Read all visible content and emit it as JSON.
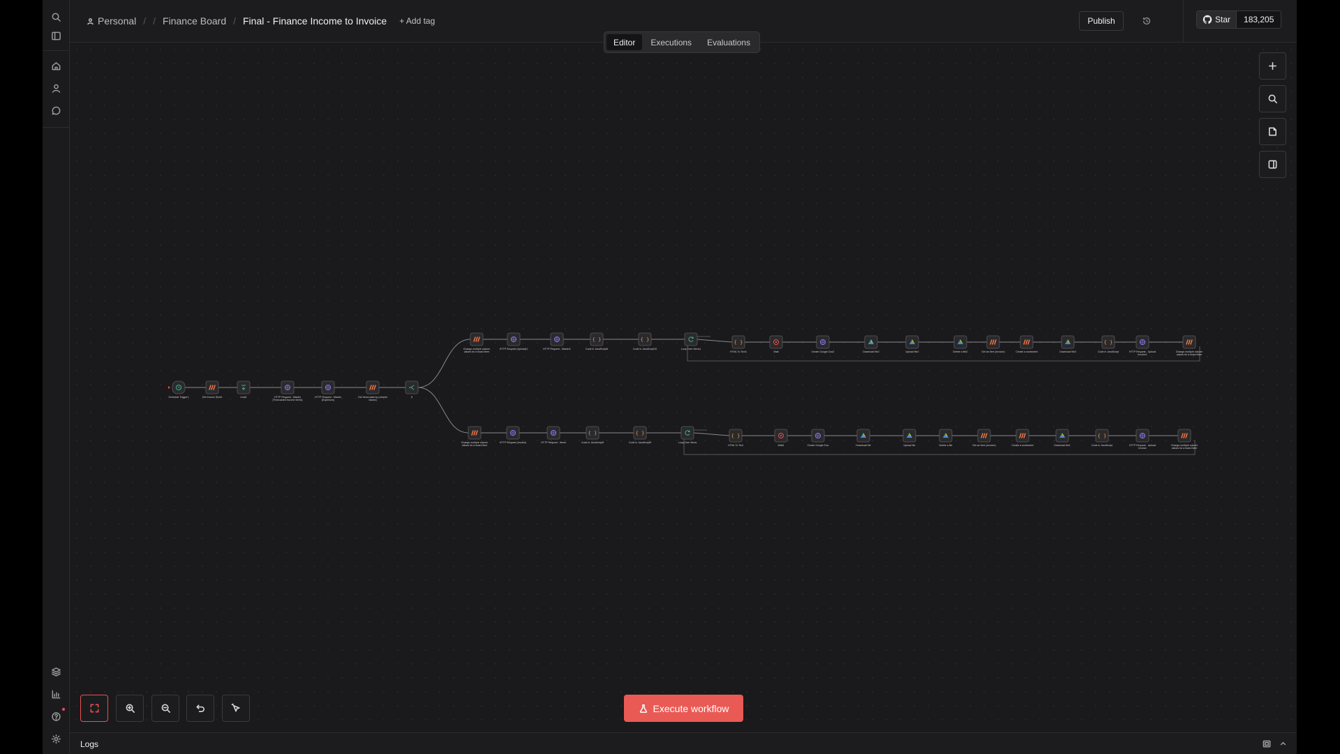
{
  "breadcrumb": {
    "project": "Personal",
    "folder": "Finance Board",
    "workflow": "Final - Finance Income to Invoice",
    "add_tag": "+ Add tag"
  },
  "header": {
    "publish": "Publish",
    "github_star": "Star",
    "github_count": "183,205"
  },
  "tabs": [
    {
      "label": "Editor",
      "active": true
    },
    {
      "label": "Executions",
      "active": false
    },
    {
      "label": "Evaluations",
      "active": false
    }
  ],
  "toolbar": {
    "execute": "Execute workflow"
  },
  "logs": {
    "label": "Logs"
  },
  "sidebar_icons": [
    "search-icon",
    "panel-icon",
    "home-icon",
    "user-icon",
    "chat-icon",
    "templates-icon",
    "insights-icon",
    "help-icon",
    "settings-icon"
  ],
  "colors": {
    "accent": "#ea5a55",
    "canvas": "#1a1a1c",
    "node": "#2a2a2d",
    "edge": "#8a8a90"
  },
  "flow": {
    "nodes": [
      {
        "id": "n1",
        "icon": "trigger",
        "title": "Schedule Trigger1",
        "sub": ""
      },
      {
        "id": "n2",
        "icon": "sheets",
        "title": "Get Invoice Sheet",
        "sub": ""
      },
      {
        "id": "n3",
        "icon": "limit",
        "title": "Limit1",
        "sub": ""
      },
      {
        "id": "n4",
        "icon": "http",
        "title": "HTTP Request - Master (Forecasted Income Items)",
        "sub": ""
      },
      {
        "id": "n5",
        "icon": "http",
        "title": "HTTP Request - Master (Expenses)",
        "sub": ""
      },
      {
        "id": "n6",
        "icon": "sheets",
        "title": "Get items data by (newest values)",
        "sub": ""
      },
      {
        "id": "n7",
        "icon": "if",
        "title": "If",
        "sub": ""
      },
      {
        "id": "u1",
        "icon": "sheets",
        "title": "Change multiple column values for a board item",
        "sub": ""
      },
      {
        "id": "u2",
        "icon": "http",
        "title": "HTTP Request (Upload)1",
        "sub": ""
      },
      {
        "id": "u3",
        "icon": "http",
        "title": "HTTP Request - Master1",
        "sub": ""
      },
      {
        "id": "u4",
        "icon": "code",
        "title": "Code in JavaScript6",
        "sub": ""
      },
      {
        "id": "u5",
        "icon": "code",
        "title": "Code in JavaScript10",
        "sub": ""
      },
      {
        "id": "u6",
        "icon": "loop",
        "title": "Loop Over Items1",
        "sub": ""
      },
      {
        "id": "u7",
        "icon": "code",
        "title": "HTML To Text1",
        "sub": ""
      },
      {
        "id": "u8",
        "icon": "wait",
        "title": "Wait",
        "sub": ""
      },
      {
        "id": "u9",
        "icon": "http",
        "title": "Create Google Doc2",
        "sub": ""
      },
      {
        "id": "u10",
        "icon": "drive",
        "title": "Download file2",
        "sub": ""
      },
      {
        "id": "u11",
        "icon": "drive",
        "title": "Upload file2",
        "sub": ""
      },
      {
        "id": "u12",
        "icon": "drive",
        "title": "Delete a file2",
        "sub": ""
      },
      {
        "id": "u13",
        "icon": "sheets",
        "title": "Get an item (Invoice)",
        "sub": ""
      },
      {
        "id": "u14",
        "icon": "sheets",
        "title": "Create a worksheet",
        "sub": ""
      },
      {
        "id": "u15",
        "icon": "drive",
        "title": "Download file3",
        "sub": ""
      },
      {
        "id": "u16",
        "icon": "code",
        "title": "Code in JavaScript",
        "sub": ""
      },
      {
        "id": "u17",
        "icon": "http",
        "title": "HTTP Request - Upload Invoice1",
        "sub": ""
      },
      {
        "id": "u18",
        "icon": "sheets",
        "title": "Change multiple column values for a board item",
        "sub": ""
      },
      {
        "id": "l1",
        "icon": "sheets",
        "title": "Change multiple column values for a board item",
        "sub": ""
      },
      {
        "id": "l2",
        "icon": "http",
        "title": "HTTP Request (Invoice)",
        "sub": ""
      },
      {
        "id": "l3",
        "icon": "http",
        "title": "HTTP Request - Items",
        "sub": ""
      },
      {
        "id": "l4",
        "icon": "code",
        "title": "Code in JavaScript5",
        "sub": ""
      },
      {
        "id": "l5",
        "icon": "code",
        "title": "Code in JavaScript9",
        "sub": ""
      },
      {
        "id": "l6",
        "icon": "loop",
        "title": "Loop Over Items",
        "sub": ""
      },
      {
        "id": "l7",
        "icon": "code",
        "title": "HTML To Text",
        "sub": ""
      },
      {
        "id": "l8",
        "icon": "wait",
        "title": "Wait1",
        "sub": ""
      },
      {
        "id": "l9",
        "icon": "http",
        "title": "Create Google Doc",
        "sub": ""
      },
      {
        "id": "l10",
        "icon": "drive",
        "title": "Download file",
        "sub": ""
      },
      {
        "id": "l11",
        "icon": "drive",
        "title": "Upload file",
        "sub": ""
      },
      {
        "id": "l12",
        "icon": "drive",
        "title": "Delete a file",
        "sub": ""
      },
      {
        "id": "l13",
        "icon": "sheets",
        "title": "Get an item (Invoice)",
        "sub": ""
      },
      {
        "id": "l14",
        "icon": "sheets",
        "title": "Create a worksheet",
        "sub": ""
      },
      {
        "id": "l15",
        "icon": "drive",
        "title": "Download file1",
        "sub": ""
      },
      {
        "id": "l16",
        "icon": "code",
        "title": "Code in JavaScript",
        "sub": ""
      },
      {
        "id": "l17",
        "icon": "http",
        "title": "HTTP Request - Upload Invoice",
        "sub": ""
      },
      {
        "id": "l18",
        "icon": "sheets",
        "title": "Change multiple column values for a board item",
        "sub": ""
      }
    ]
  }
}
